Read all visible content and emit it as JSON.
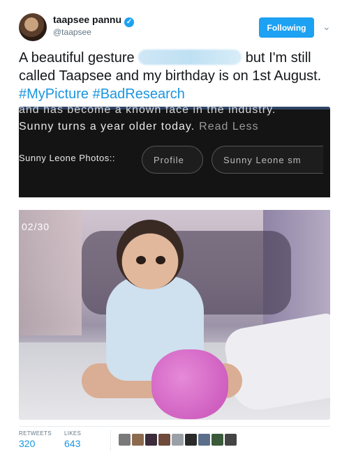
{
  "user": {
    "name": "taapsee pannu",
    "handle": "@taapsee",
    "verified_mark": "✓"
  },
  "actions": {
    "follow_label": "Following",
    "chevron": "⌄"
  },
  "tweet": {
    "text_before": "A beautiful gesture ",
    "text_after": " but I'm still called Taapsee and my birthday is on 1st August. ",
    "hashtags": [
      "#MyPicture",
      "#BadResearch"
    ]
  },
  "media": {
    "cut_off_line": "and has become a known face in the industry.",
    "sunny_line": "Sunny turns a year older today.",
    "read_less": "Read Less",
    "photos_label": "Sunny Leone Photos::",
    "pills": [
      "Profile",
      "Sunny Leone sm"
    ],
    "counter": "02/30"
  },
  "stats": {
    "retweets_label": "RETWEETS",
    "retweets_value": "320",
    "likes_label": "LIKES",
    "likes_value": "643"
  },
  "colors": {
    "accent": "#1da1f2",
    "link": "#1b95e0",
    "muted": "#657786"
  },
  "likers": [
    "#7a7a7a",
    "#8b6a4e",
    "#3c2b3a",
    "#6e4b3a",
    "#9aa0a6",
    "#2a2a2a",
    "#5b6f8a",
    "#3a5a3a",
    "#444444"
  ]
}
